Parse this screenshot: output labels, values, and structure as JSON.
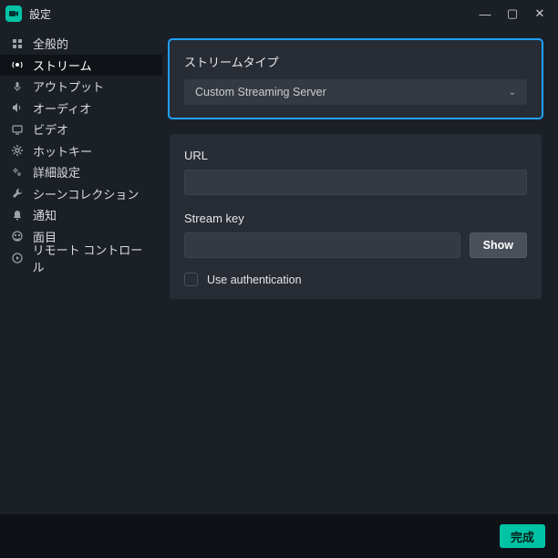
{
  "window": {
    "title": "設定"
  },
  "sidebar": {
    "items": [
      {
        "label": "全般的",
        "icon": "grid"
      },
      {
        "label": "ストリーム",
        "icon": "stream",
        "active": true
      },
      {
        "label": "アウトプット",
        "icon": "mic"
      },
      {
        "label": "オーディオ",
        "icon": "speaker"
      },
      {
        "label": "ビデオ",
        "icon": "monitor"
      },
      {
        "label": "ホットキー",
        "icon": "gear"
      },
      {
        "label": "詳細設定",
        "icon": "gears"
      },
      {
        "label": "シーンコレクション",
        "icon": "wrench"
      },
      {
        "label": "通知",
        "icon": "bell"
      },
      {
        "label": "面目",
        "icon": "face"
      },
      {
        "label": "リモート コントロール",
        "icon": "remote"
      }
    ]
  },
  "stream": {
    "type": {
      "label": "ストリームタイプ",
      "value": "Custom Streaming Server"
    },
    "url": {
      "label": "URL",
      "value": ""
    },
    "key": {
      "label": "Stream key",
      "value": "",
      "show_button": "Show"
    },
    "auth": {
      "label": "Use authentication",
      "checked": false
    }
  },
  "footer": {
    "done": "完成"
  }
}
